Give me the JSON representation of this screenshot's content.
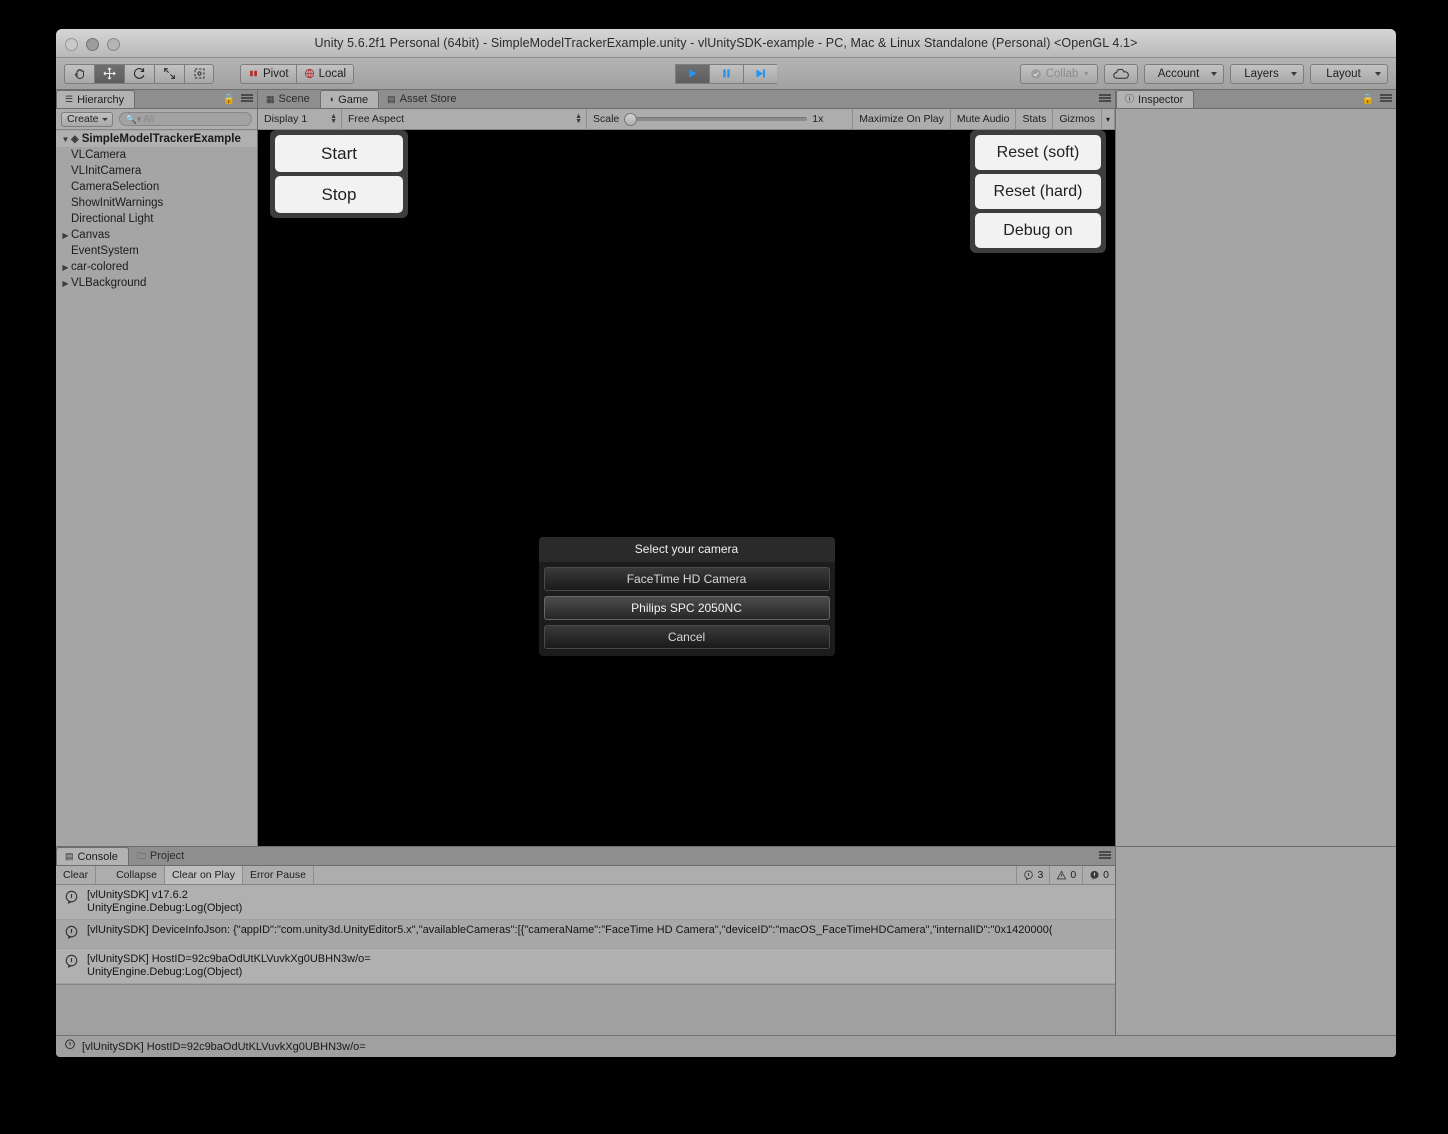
{
  "window": {
    "title": "Unity 5.6.2f1 Personal (64bit) - SimpleModelTrackerExample.unity - vlUnitySDK-example - PC, Mac & Linux Standalone (Personal) <OpenGL 4.1>",
    "traffic_lights": [
      "close-button",
      "minimize-button",
      "zoom-button"
    ]
  },
  "toolbar": {
    "tools": [
      {
        "name": "hand-tool",
        "icon": "hand-icon",
        "selected": false
      },
      {
        "name": "move-tool",
        "icon": "move-icon",
        "selected": true
      },
      {
        "name": "rotate-tool",
        "icon": "rotate-icon",
        "selected": false
      },
      {
        "name": "scale-tool",
        "icon": "scale-icon",
        "selected": false
      },
      {
        "name": "rect-tool",
        "icon": "rect-transform-icon",
        "selected": false
      }
    ],
    "pivot_label": "Pivot",
    "local_label": "Local",
    "play_label": "play-icon",
    "pause_label": "pause-icon",
    "step_label": "step-icon",
    "collab_label": "Collab",
    "cloud_label": "cloud-icon",
    "account_label": "Account",
    "layers_label": "Layers",
    "layout_label": "Layout"
  },
  "hierarchy": {
    "tab_label": "Hierarchy",
    "create_label": "Create",
    "search_placeholder": "All",
    "search_value": "",
    "root": "SimpleModelTrackerExample",
    "items": [
      {
        "label": "VLCamera",
        "expandable": false
      },
      {
        "label": "VLInitCamera",
        "expandable": false
      },
      {
        "label": "CameraSelection",
        "expandable": false
      },
      {
        "label": "ShowInitWarnings",
        "expandable": false
      },
      {
        "label": "Directional Light",
        "expandable": false
      },
      {
        "label": "Canvas",
        "expandable": true
      },
      {
        "label": "EventSystem",
        "expandable": false
      },
      {
        "label": "car-colored",
        "expandable": true
      },
      {
        "label": "VLBackground",
        "expandable": true
      }
    ]
  },
  "center_tabs": [
    {
      "label": "Scene",
      "icon": "grid-icon",
      "active": false
    },
    {
      "label": "Game",
      "icon": "gamepad-icon",
      "active": true
    },
    {
      "label": "Asset Store",
      "icon": "store-icon",
      "active": false
    }
  ],
  "game_toolbar": {
    "display": "Display 1",
    "aspect": "Free Aspect",
    "scale_label": "Scale",
    "scale_value": "1x",
    "maximize_on_play": "Maximize On Play",
    "mute_audio": "Mute Audio",
    "stats": "Stats",
    "gizmos": "Gizmos"
  },
  "game_overlay": {
    "left_buttons": [
      "Start",
      "Stop"
    ],
    "right_buttons": [
      "Reset (soft)",
      "Reset (hard)",
      "Debug on"
    ]
  },
  "camera_dialog": {
    "title": "Select your camera",
    "options": [
      {
        "label": "FaceTime HD Camera",
        "highlighted": false
      },
      {
        "label": "Philips SPC 2050NC",
        "highlighted": true
      }
    ],
    "cancel_label": "Cancel"
  },
  "inspector": {
    "tab_label": "Inspector"
  },
  "console": {
    "tabs": [
      {
        "label": "Console",
        "icon": "console-icon",
        "active": true
      },
      {
        "label": "Project",
        "icon": "folder-icon",
        "active": false
      }
    ],
    "clear_label": "Clear",
    "collapse_label": "Collapse",
    "clear_on_play_label": "Clear on Play",
    "error_pause_label": "Error Pause",
    "info_count": "3",
    "warning_count": "0",
    "error_count": "0",
    "entries": [
      {
        "line1": "[vlUnitySDK] v17.6.2",
        "line2": "UnityEngine.Debug:Log(Object)"
      },
      {
        "line1": "[vlUnitySDK] DeviceInfoJson: {\"appID\":\"com.unity3d.UnityEditor5.x\",\"availableCameras\":[{\"cameraName\":\"FaceTime HD Camera\",\"deviceID\":\"macOS_FaceTimeHDCamera\",\"internalID\":\"0x1420000(",
        "line2": ""
      },
      {
        "line1": "[vlUnitySDK] HostID=92c9baOdUtKLVuvkXg0UBHN3w/o=",
        "line2": "UnityEngine.Debug:Log(Object)"
      }
    ]
  },
  "statusbar": {
    "message": "[vlUnitySDK] HostID=92c9baOdUtKLVuvkXg0UBHN3w/o="
  },
  "colors": {
    "chrome": "#a1a1a1",
    "panel": "#a5a5a5",
    "game_bg": "#000000",
    "accent_play": "#2196f3",
    "dialog_bg": "#1c1c1c"
  }
}
